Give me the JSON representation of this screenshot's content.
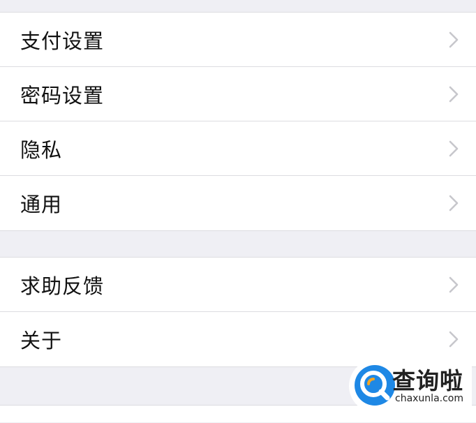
{
  "group1": {
    "items": [
      {
        "label": "支付设置"
      },
      {
        "label": "密码设置"
      },
      {
        "label": "隐私"
      },
      {
        "label": "通用"
      }
    ]
  },
  "group2": {
    "items": [
      {
        "label": "求助反馈"
      },
      {
        "label": "关于"
      }
    ]
  },
  "watermark": {
    "title": "查询啦",
    "url": "chaxunla.com"
  },
  "icons": {
    "row_chevron": "chevron-right-icon",
    "watermark_logo": "search-q-logo"
  },
  "colors": {
    "background": "#efeff4",
    "cell": "#ffffff",
    "separator": "#dcdce0",
    "chevron": "#c7c7cc",
    "logo_blue": "#1e88e5",
    "logo_orange": "#f5a623"
  }
}
